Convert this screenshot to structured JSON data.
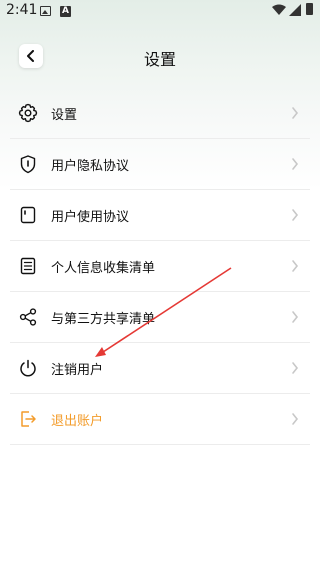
{
  "status_bar": {
    "time": "2:41",
    "a_badge": "A"
  },
  "header": {
    "title": "设置"
  },
  "menu": {
    "items": [
      {
        "label": "设置",
        "icon": "gear-icon"
      },
      {
        "label": "用户隐私协议",
        "icon": "shield-icon"
      },
      {
        "label": "用户使用协议",
        "icon": "document-icon"
      },
      {
        "label": "个人信息收集清单",
        "icon": "list-icon"
      },
      {
        "label": "与第三方共享清单",
        "icon": "share-icon"
      },
      {
        "label": "注销用户",
        "icon": "power-icon"
      },
      {
        "label": "退出账户",
        "icon": "logout-icon"
      }
    ]
  },
  "colors": {
    "accent_orange": "#f39c2b",
    "annotation_red": "#e53935",
    "text": "#111111"
  }
}
